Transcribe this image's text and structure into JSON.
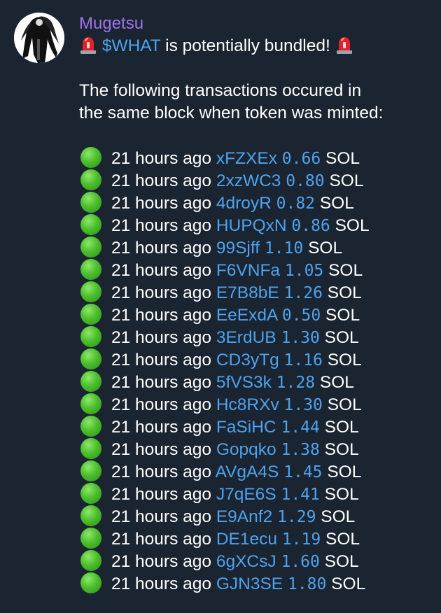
{
  "sender": "Mugetsu",
  "headline": {
    "before": "",
    "ticker": "$WHAT",
    "after": " is potentially bundled! "
  },
  "intro": [
    "The following transactions occured in",
    "the same block when token was minted:"
  ],
  "transactions": [
    {
      "time": "21 hours ago",
      "wallet": "xFZXEx",
      "amount": "0.66",
      "unit": "SOL"
    },
    {
      "time": "21 hours ago",
      "wallet": "2xzWC3",
      "amount": "0.80",
      "unit": "SOL"
    },
    {
      "time": "21 hours ago",
      "wallet": "4droyR",
      "amount": "0.82",
      "unit": "SOL"
    },
    {
      "time": "21 hours ago",
      "wallet": "HUPQxN",
      "amount": "0.86",
      "unit": "SOL"
    },
    {
      "time": "21 hours ago",
      "wallet": "99Sjff",
      "amount": "1.10",
      "unit": "SOL"
    },
    {
      "time": "21 hours ago",
      "wallet": "F6VNFa",
      "amount": "1.05",
      "unit": "SOL"
    },
    {
      "time": "21 hours ago",
      "wallet": "E7B8bE",
      "amount": "1.26",
      "unit": "SOL"
    },
    {
      "time": "21 hours ago",
      "wallet": "EeExdA",
      "amount": "0.50",
      "unit": "SOL"
    },
    {
      "time": "21 hours ago",
      "wallet": "3ErdUB",
      "amount": "1.30",
      "unit": "SOL"
    },
    {
      "time": "21 hours ago",
      "wallet": "CD3yTg",
      "amount": "1.16",
      "unit": "SOL"
    },
    {
      "time": "21 hours ago",
      "wallet": "5fVS3k",
      "amount": "1.28",
      "unit": "SOL"
    },
    {
      "time": "21 hours ago",
      "wallet": "Hc8RXv",
      "amount": "1.30",
      "unit": "SOL"
    },
    {
      "time": "21 hours ago",
      "wallet": "FaSiHC",
      "amount": "1.44",
      "unit": "SOL"
    },
    {
      "time": "21 hours ago",
      "wallet": "Gopqko",
      "amount": "1.38",
      "unit": "SOL"
    },
    {
      "time": "21 hours ago",
      "wallet": "AVgA4S",
      "amount": "1.45",
      "unit": "SOL"
    },
    {
      "time": "21 hours ago",
      "wallet": "J7qE6S",
      "amount": "1.41",
      "unit": "SOL"
    },
    {
      "time": "21 hours ago",
      "wallet": "E9Anf2",
      "amount": "1.29",
      "unit": "SOL"
    },
    {
      "time": "21 hours ago",
      "wallet": "DE1ecu",
      "amount": "1.19",
      "unit": "SOL"
    },
    {
      "time": "21 hours ago",
      "wallet": "6gXCsJ",
      "amount": "1.60",
      "unit": "SOL"
    },
    {
      "time": "21 hours ago",
      "wallet": "GJN3SE",
      "amount": "1.80",
      "unit": "SOL"
    }
  ],
  "icons": {
    "alert": "rotating-light-icon",
    "status": "green-circle-icon"
  },
  "colors": {
    "background": "#1b2431",
    "sender": "#a172ea",
    "link": "#4ea3ee",
    "text": "#ffffff"
  }
}
